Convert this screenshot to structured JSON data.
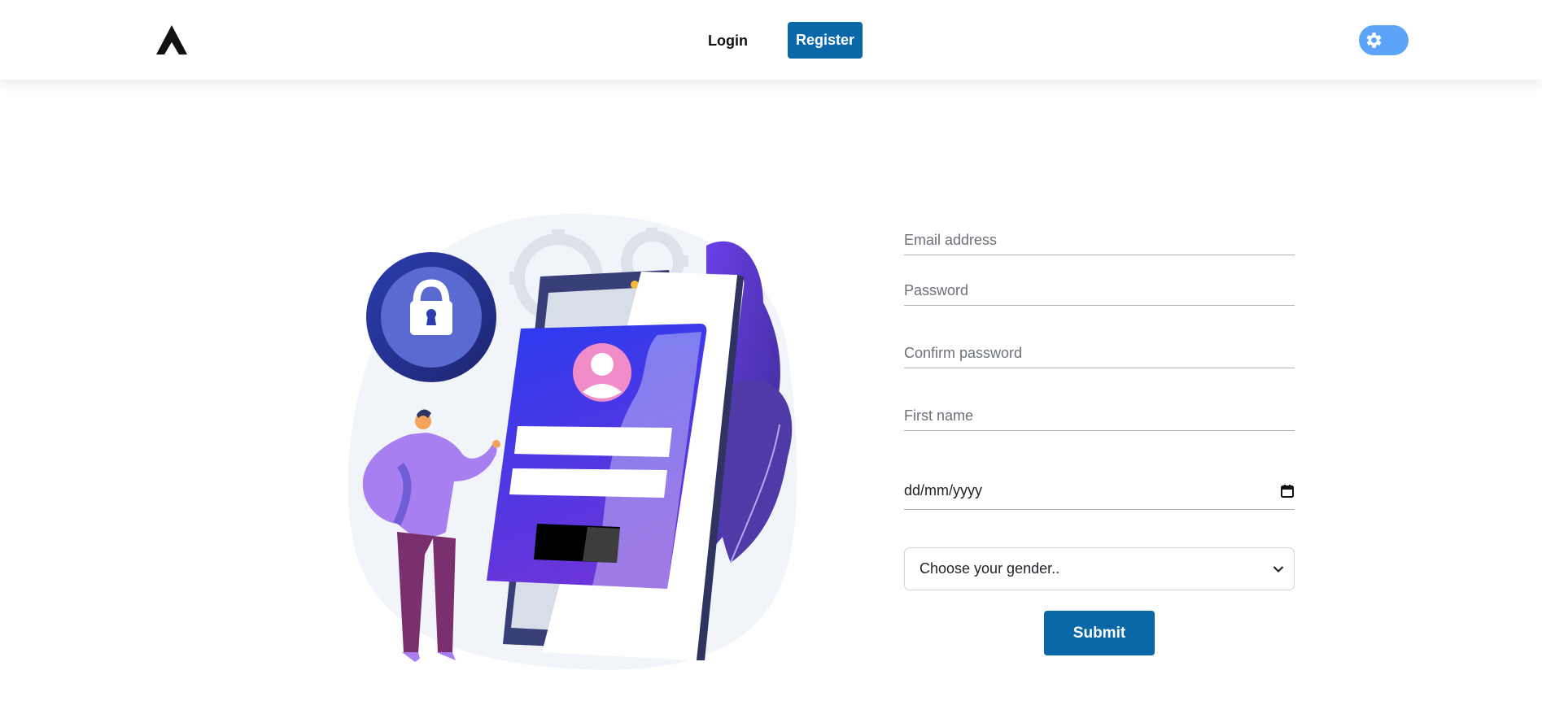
{
  "nav": {
    "login_label": "Login",
    "register_label": "Register"
  },
  "form": {
    "email_placeholder": "Email address",
    "password_placeholder": "Password",
    "confirm_password_placeholder": "Confirm password",
    "first_name_placeholder": "First name",
    "date_value": "dd/mm/yyyy",
    "gender_selected": "Choose your gender..",
    "submit_label": "Submit"
  },
  "icons": {
    "logo": "logo-icon",
    "theme_toggle": "gear-icon",
    "date_picker": "calendar-icon",
    "select_arrow": "chevron-down-icon"
  },
  "colors": {
    "primary": "#0a67a8",
    "toggle": "#5ba4f7",
    "text_dark": "#111111",
    "placeholder": "#6c7178"
  }
}
